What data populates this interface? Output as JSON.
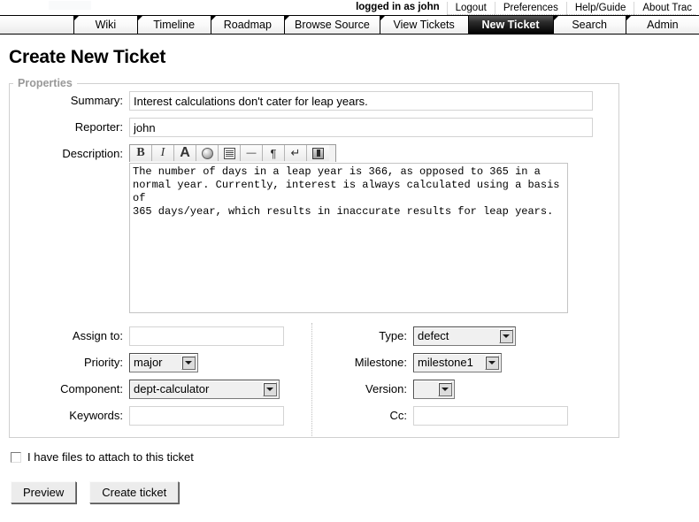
{
  "metanav": {
    "status": "logged in as john",
    "links": [
      "Logout",
      "Preferences",
      "Help/Guide",
      "About Trac"
    ]
  },
  "mainnav": {
    "tabs": [
      {
        "label": "Wiki",
        "active": false
      },
      {
        "label": "Timeline",
        "active": false
      },
      {
        "label": "Roadmap",
        "active": false
      },
      {
        "label": "Browse Source",
        "active": false
      },
      {
        "label": "View Tickets",
        "active": false
      },
      {
        "label": "New Ticket",
        "active": true
      },
      {
        "label": "Search",
        "active": false
      },
      {
        "label": "Admin",
        "active": false
      }
    ]
  },
  "page": {
    "title": "Create New Ticket",
    "fieldset_legend": "Properties"
  },
  "form": {
    "summary": {
      "label": "Summary:",
      "value": "Interest calculations don't cater for leap years."
    },
    "reporter": {
      "label": "Reporter:",
      "value": "john"
    },
    "description": {
      "label": "Description:",
      "value": "The number of days in a leap year is 366, as opposed to 365 in a\nnormal year. Currently, interest is always calculated using a basis of\n365 days/year, which results in inaccurate results for leap years."
    },
    "toolbar": {
      "bold": "B",
      "italic": "I",
      "heading": "A",
      "link": "link-globe-icon",
      "list": "list-icon",
      "hrule": "—",
      "paragraph": "¶",
      "linebreak": "↵",
      "image": "image-icon"
    },
    "assign_to": {
      "label": "Assign to:",
      "value": ""
    },
    "priority": {
      "label": "Priority:",
      "value": "major"
    },
    "component": {
      "label": "Component:",
      "value": "dept-calculator"
    },
    "keywords": {
      "label": "Keywords:",
      "value": ""
    },
    "type": {
      "label": "Type:",
      "value": "defect"
    },
    "milestone": {
      "label": "Milestone:",
      "value": "milestone1"
    },
    "version": {
      "label": "Version:",
      "value": ""
    },
    "cc": {
      "label": "Cc:",
      "value": ""
    },
    "attachment": {
      "label": "I have files to attach to this ticket",
      "checked": false
    },
    "buttons": {
      "preview": "Preview",
      "create": "Create ticket"
    }
  }
}
